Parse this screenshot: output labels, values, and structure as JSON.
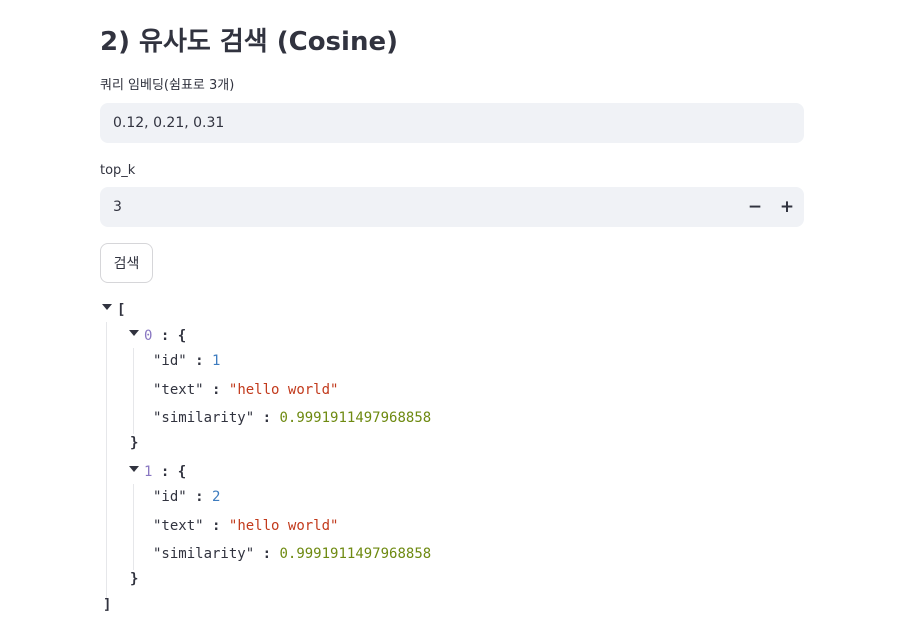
{
  "section": {
    "title": "2) 유사도 검색 (Cosine)"
  },
  "query_field": {
    "label": "쿼리 임베딩(쉼표로 3개)",
    "value": "0.12, 0.21, 0.31"
  },
  "top_k_field": {
    "label": "top_k",
    "value": "3",
    "minus": "−",
    "plus": "+"
  },
  "search_button": {
    "label": "검색"
  },
  "result": {
    "open_bracket": "[",
    "close_bracket": "]",
    "open_brace": "{",
    "close_brace": "}",
    "colon": ":",
    "items": [
      {
        "index": "0",
        "fields": [
          {
            "key": "\"id\"",
            "value": "1"
          },
          {
            "key": "\"text\"",
            "value": "\"hello world\""
          },
          {
            "key": "\"similarity\"",
            "value": "0.9991911497968858"
          }
        ]
      },
      {
        "index": "1",
        "fields": [
          {
            "key": "\"id\"",
            "value": "2"
          },
          {
            "key": "\"text\"",
            "value": "\"hello world\""
          },
          {
            "key": "\"similarity\"",
            "value": "0.9991911497968858"
          }
        ]
      }
    ]
  },
  "colors": {
    "text": "#31333f",
    "field_bg": "#f0f2f6",
    "json_index": "#8977c2",
    "json_number": "#3d7cbf",
    "json_string": "#c23a1c",
    "json_float": "#6e8a11"
  }
}
